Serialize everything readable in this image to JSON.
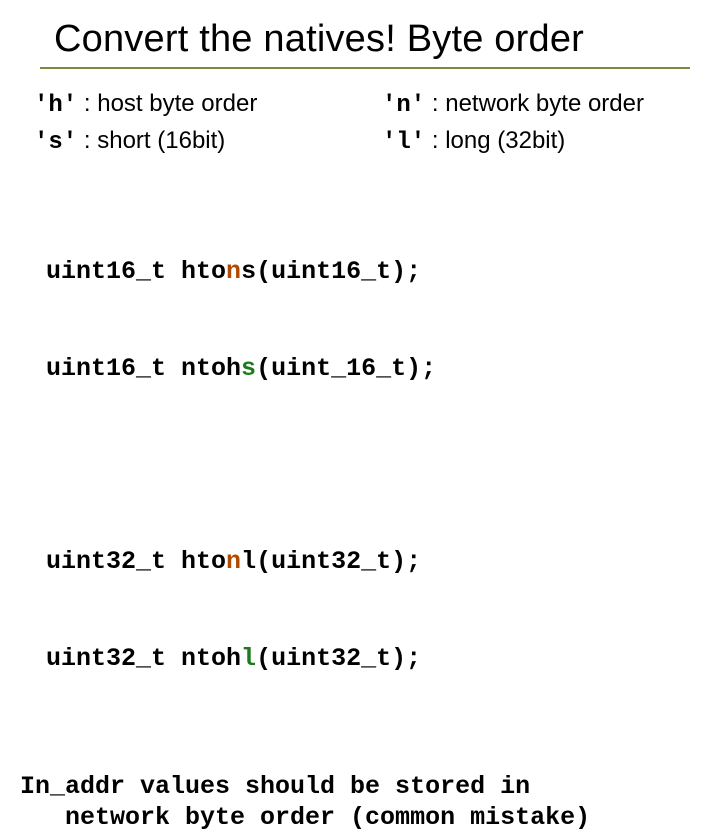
{
  "title": "Convert the natives! Byte order",
  "definitions": {
    "left": [
      {
        "lit": "'h'",
        "desc": ": host byte order"
      },
      {
        "lit": "'s'",
        "desc": ": short (16bit)"
      }
    ],
    "right": [
      {
        "lit": "'n'",
        "desc": ": network byte order"
      },
      {
        "lit": "'l'",
        "desc": ": long (32bit)"
      }
    ]
  },
  "code1": {
    "l1": {
      "ret": "uint16_t ",
      "fn_pre": "hto",
      "fn_hl": "n",
      "fn_post": "s",
      "args": "(uint16_t);"
    },
    "l2": {
      "ret": "uint16_t ",
      "fn_pre": "ntoh",
      "fn_hl": "s",
      "fn_post": "",
      "args": "(uint_16_t);"
    }
  },
  "code2": {
    "l1": {
      "ret": "uint32_t ",
      "fn_pre": "hto",
      "fn_hl": "n",
      "fn_post": "l",
      "args": "(uint32_t);"
    },
    "l2": {
      "ret": "uint32_t ",
      "fn_pre": "ntoh",
      "fn_hl": "l",
      "fn_post": "",
      "args": "(uint32_t);"
    }
  },
  "note_line1": "In_addr values should be stored in",
  "note_line2": "   network byte order (common mistake)"
}
